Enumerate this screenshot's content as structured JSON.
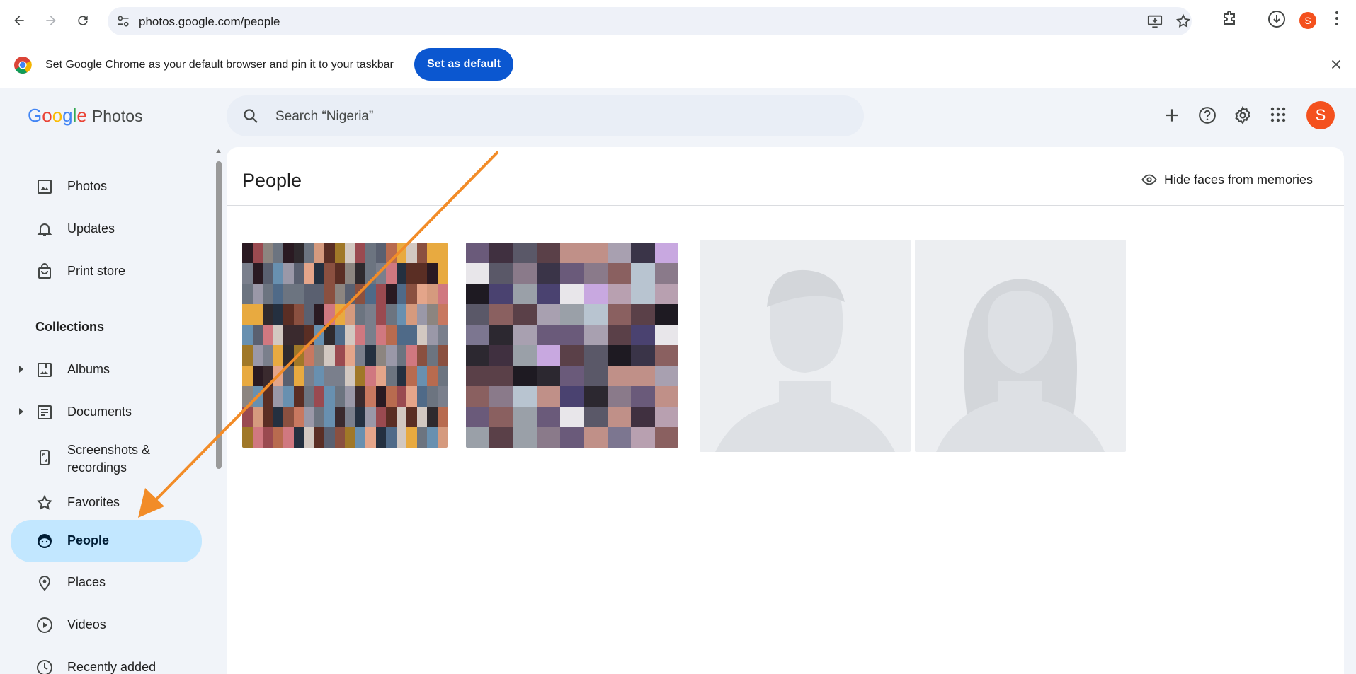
{
  "browser": {
    "url": "photos.google.com/people",
    "profile_initial": "S"
  },
  "infobar": {
    "message": "Set Google Chrome as your default browser and pin it to your taskbar",
    "button_label": "Set as default"
  },
  "app": {
    "logo_google": "Google",
    "logo_product": "Photos",
    "search_placeholder": "Search “Nigeria”",
    "avatar_initial": "S"
  },
  "sidebar": {
    "items": [
      {
        "label": "Photos",
        "icon": "photo-icon"
      },
      {
        "label": "Updates",
        "icon": "bell-icon"
      },
      {
        "label": "Print store",
        "icon": "shopping-bag-icon"
      }
    ],
    "collections_label": "Collections",
    "collections": [
      {
        "label": "Albums",
        "icon": "album-icon",
        "expandable": true
      },
      {
        "label": "Documents",
        "icon": "document-icon",
        "expandable": true
      },
      {
        "label": "Screenshots & recordings",
        "icon": "phone-icon",
        "expandable": false
      },
      {
        "label": "Favorites",
        "icon": "star-icon",
        "expandable": false
      },
      {
        "label": "People",
        "icon": "face-icon",
        "expandable": false,
        "active": true
      },
      {
        "label": "Places",
        "icon": "location-pin-icon",
        "expandable": false
      },
      {
        "label": "Videos",
        "icon": "play-circle-icon",
        "expandable": false
      },
      {
        "label": "Recently added",
        "icon": "clock-icon",
        "expandable": false
      }
    ]
  },
  "main": {
    "title": "People",
    "hide_faces_label": "Hide faces from memories",
    "faces": [
      {
        "kind": "pixelated-photo"
      },
      {
        "kind": "pixelated-photo"
      },
      {
        "kind": "placeholder-male"
      },
      {
        "kind": "placeholder-female"
      }
    ]
  },
  "colors": {
    "accent": "#0b57d0",
    "active_nav": "#c2e7ff",
    "avatar": "#f4511e",
    "annotation_arrow": "#f28c28"
  }
}
